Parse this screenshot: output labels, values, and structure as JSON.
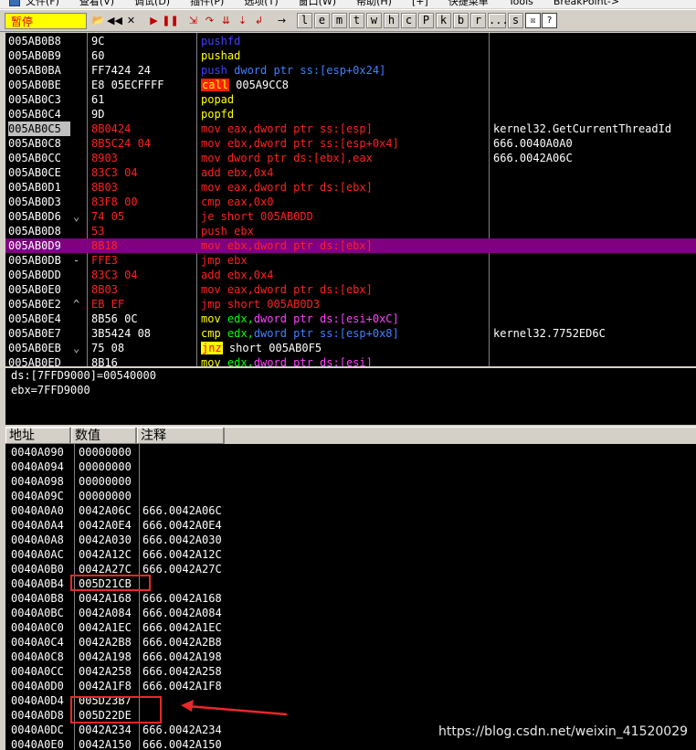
{
  "menubar": {
    "items": [
      "文件(F)",
      "查看(V)",
      "调试(D)",
      "插件(P)",
      "选项(T)",
      "窗口(W)",
      "帮助(H)",
      "[+]",
      "快捷菜单",
      "Tools",
      "BreakPoint->"
    ]
  },
  "toolbar": {
    "status": "暂停",
    "letters": [
      "l",
      "e",
      "m",
      "t",
      "w",
      "h",
      "c",
      "P",
      "k",
      "b",
      "r",
      "...",
      "s"
    ]
  },
  "disasm": [
    {
      "addr": "005AB0B8",
      "mark": "",
      "hex": "9C",
      "hexColor": "white",
      "asm": [
        {
          "t": "pushfd",
          "c": "push"
        }
      ],
      "cmt": ""
    },
    {
      "addr": "005AB0B9",
      "mark": "",
      "hex": "60",
      "hexColor": "white",
      "asm": [
        {
          "t": "pushad",
          "c": "yellow"
        }
      ],
      "cmt": ""
    },
    {
      "addr": "005AB0BA",
      "mark": "",
      "hex": "FF7424 24",
      "hexColor": "white",
      "asm": [
        {
          "t": "push ",
          "c": "push"
        },
        {
          "t": "dword ptr ss:[esp+0x24]",
          "c": "blue"
        }
      ],
      "cmt": ""
    },
    {
      "addr": "005AB0BE",
      "mark": "",
      "hex": "E8 05ECFFFF",
      "hexColor": "white",
      "asm": [
        {
          "t": "call",
          "c": "call"
        },
        {
          "t": " 005A9CC8",
          "c": "white"
        }
      ],
      "cmt": ""
    },
    {
      "addr": "005AB0C3",
      "mark": "",
      "hex": "61",
      "hexColor": "white",
      "asm": [
        {
          "t": "popad",
          "c": "yellow"
        }
      ],
      "cmt": ""
    },
    {
      "addr": "005AB0C4",
      "mark": "",
      "hex": "9D",
      "hexColor": "white",
      "asm": [
        {
          "t": "popfd",
          "c": "yellow"
        }
      ],
      "cmt": ""
    },
    {
      "addr": "005AB0C5",
      "mark": "",
      "hex": "8B0424",
      "hexColor": "red",
      "asm": [
        {
          "t": "mov eax,dword ptr ss:[esp]",
          "c": "red"
        }
      ],
      "cmt": "kernel32.GetCurrentThreadId",
      "current": true
    },
    {
      "addr": "005AB0C8",
      "mark": "",
      "hex": "8B5C24 04",
      "hexColor": "red",
      "asm": [
        {
          "t": "mov ebx,dword ptr ss:[esp+0x4]",
          "c": "red"
        }
      ],
      "cmt": "666.0040A0A0"
    },
    {
      "addr": "005AB0CC",
      "mark": "",
      "hex": "8903",
      "hexColor": "red",
      "asm": [
        {
          "t": "mov dword ptr ds:[ebx],eax",
          "c": "red"
        }
      ],
      "cmt": "666.0042A06C"
    },
    {
      "addr": "005AB0CE",
      "mark": "",
      "hex": "83C3 04",
      "hexColor": "red",
      "asm": [
        {
          "t": "add ebx,0x4",
          "c": "red"
        }
      ],
      "cmt": ""
    },
    {
      "addr": "005AB0D1",
      "mark": "",
      "hex": "8B03",
      "hexColor": "red",
      "asm": [
        {
          "t": "mov eax,dword ptr ds:[ebx]",
          "c": "red"
        }
      ],
      "cmt": ""
    },
    {
      "addr": "005AB0D3",
      "mark": "",
      "hex": "83F8 00",
      "hexColor": "red",
      "asm": [
        {
          "t": "cmp eax,0x0",
          "c": "red"
        }
      ],
      "cmt": ""
    },
    {
      "addr": "005AB0D6",
      "mark": "⌄",
      "hex": "74 05",
      "hexColor": "red",
      "asm": [
        {
          "t": "je short 005AB0DD",
          "c": "red"
        }
      ],
      "cmt": ""
    },
    {
      "addr": "005AB0D8",
      "mark": "",
      "hex": "53",
      "hexColor": "red",
      "asm": [
        {
          "t": "push ebx",
          "c": "red"
        }
      ],
      "cmt": ""
    },
    {
      "addr": "005AB0D9",
      "mark": "",
      "hex": "8B18",
      "hexColor": "red",
      "asm": [
        {
          "t": "mov ebx,dword ptr ds:[ebx]",
          "c": "red"
        }
      ],
      "cmt": "",
      "highlight": true
    },
    {
      "addr": "005AB0DB",
      "mark": "-",
      "hex": "FFE3",
      "hexColor": "red",
      "asm": [
        {
          "t": "jmp ebx",
          "c": "red"
        }
      ],
      "cmt": ""
    },
    {
      "addr": "005AB0DD",
      "mark": "",
      "hex": "83C3 04",
      "hexColor": "red",
      "asm": [
        {
          "t": "add ebx,0x4",
          "c": "red"
        }
      ],
      "cmt": ""
    },
    {
      "addr": "005AB0E0",
      "mark": "",
      "hex": "8B03",
      "hexColor": "red",
      "asm": [
        {
          "t": "mov eax,dword ptr ds:[ebx]",
          "c": "red"
        }
      ],
      "cmt": ""
    },
    {
      "addr": "005AB0E2",
      "mark": "^",
      "hex": "EB EF",
      "hexColor": "red",
      "asm": [
        {
          "t": "jmp short 005AB0D3",
          "c": "red"
        }
      ],
      "cmt": ""
    },
    {
      "addr": "005AB0E4",
      "mark": "",
      "hex": "8B56 0C",
      "hexColor": "white",
      "asm": [
        {
          "t": "mov ",
          "c": "yellow"
        },
        {
          "t": "edx,",
          "c": "green"
        },
        {
          "t": "dword ptr ds:[esi+0xC]",
          "c": "magenta"
        }
      ],
      "cmt": ""
    },
    {
      "addr": "005AB0E7",
      "mark": "",
      "hex": "3B5424 08",
      "hexColor": "white",
      "asm": [
        {
          "t": "cmp ",
          "c": "yellow"
        },
        {
          "t": "edx,",
          "c": "green"
        },
        {
          "t": "dword ptr ss:[esp+0x8]",
          "c": "blue"
        }
      ],
      "cmt": "kernel32.7752ED6C"
    },
    {
      "addr": "005AB0EB",
      "mark": "⌄",
      "hex": "75 08",
      "hexColor": "white",
      "asm": [
        {
          "t": "jnz",
          "c": "jnz"
        },
        {
          "t": " short 005AB0F5",
          "c": "white"
        }
      ],
      "cmt": ""
    },
    {
      "addr": "005AB0ED",
      "mark": "",
      "hex": "8B16",
      "hexColor": "white",
      "asm": [
        {
          "t": "mov ",
          "c": "yellow"
        },
        {
          "t": "edx,",
          "c": "green"
        },
        {
          "t": "dword ptr ds:[esi]",
          "c": "magenta"
        }
      ],
      "cmt": ""
    }
  ],
  "info": {
    "line1": "ds:[7FFD9000]=00540000",
    "line2": "ebx=7FFD9000"
  },
  "stack": {
    "headers": [
      "地址",
      "数值",
      "注释"
    ],
    "rows": [
      [
        "0040A090",
        "00000000",
        ""
      ],
      [
        "0040A094",
        "00000000",
        ""
      ],
      [
        "0040A098",
        "00000000",
        ""
      ],
      [
        "0040A09C",
        "00000000",
        ""
      ],
      [
        "0040A0A0",
        "0042A06C",
        "666.0042A06C"
      ],
      [
        "0040A0A4",
        "0042A0E4",
        "666.0042A0E4"
      ],
      [
        "0040A0A8",
        "0042A030",
        "666.0042A030"
      ],
      [
        "0040A0AC",
        "0042A12C",
        "666.0042A12C"
      ],
      [
        "0040A0B0",
        "0042A27C",
        "666.0042A27C"
      ],
      [
        "0040A0B4",
        "005D21CB",
        ""
      ],
      [
        "0040A0B8",
        "0042A168",
        "666.0042A168"
      ],
      [
        "0040A0BC",
        "0042A084",
        "666.0042A084"
      ],
      [
        "0040A0C0",
        "0042A1EC",
        "666.0042A1EC"
      ],
      [
        "0040A0C4",
        "0042A2B8",
        "666.0042A2B8"
      ],
      [
        "0040A0C8",
        "0042A198",
        "666.0042A198"
      ],
      [
        "0040A0CC",
        "0042A258",
        "666.0042A258"
      ],
      [
        "0040A0D0",
        "0042A1F8",
        "666.0042A1F8"
      ],
      [
        "0040A0D4",
        "005D23B7",
        ""
      ],
      [
        "0040A0D8",
        "005D22DE",
        ""
      ],
      [
        "0040A0DC",
        "0042A234",
        "666.0042A234"
      ],
      [
        "0040A0E0",
        "0042A150",
        "666.0042A150"
      ]
    ]
  },
  "watermark": "https://blog.csdn.net/weixin_41520029"
}
